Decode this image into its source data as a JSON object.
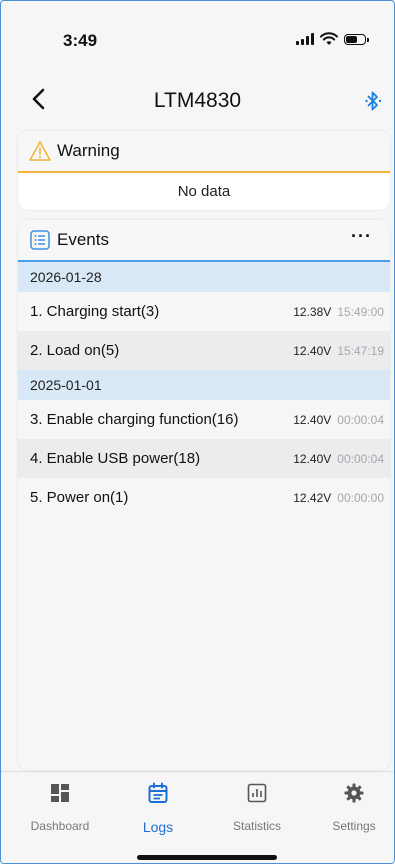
{
  "status_bar": {
    "time": "3:49"
  },
  "nav": {
    "title": "LTM4830",
    "back_icon": "chevron-left-icon",
    "bluetooth_icon": "bluetooth-icon"
  },
  "warning": {
    "title": "Warning",
    "empty_text": "No data",
    "icon": "warning-triangle-icon",
    "accent": "#f0b43a"
  },
  "events": {
    "title": "Events",
    "icon": "list-icon",
    "more_label": "···",
    "accent": "#4a9fe8",
    "groups": [
      {
        "date": "2026-01-28",
        "items": [
          {
            "label": "1. Charging start(3)",
            "voltage": "12.38V",
            "time": "15:49:00"
          },
          {
            "label": "2. Load on(5)",
            "voltage": "12.40V",
            "time": "15:47:19"
          }
        ]
      },
      {
        "date": "2025-01-01",
        "items": [
          {
            "label": "3. Enable charging function(16)",
            "voltage": "12.40V",
            "time": "00:00:04"
          },
          {
            "label": "4. Enable USB power(18)",
            "voltage": "12.40V",
            "time": "00:00:04"
          },
          {
            "label": "5. Power on(1)",
            "voltage": "12.42V",
            "time": "00:00:00"
          }
        ]
      }
    ]
  },
  "tabs": [
    {
      "label": "Dashboard",
      "icon": "dashboard-icon",
      "active": false
    },
    {
      "label": "Logs",
      "icon": "calendar-icon",
      "active": true
    },
    {
      "label": "Statistics",
      "icon": "chart-icon",
      "active": false
    },
    {
      "label": "Settings",
      "icon": "gear-icon",
      "active": false
    }
  ],
  "colors": {
    "active_tab": "#1d6fd6",
    "inactive_tab": "#777777",
    "date_row_bg": "#d8e8f6"
  }
}
